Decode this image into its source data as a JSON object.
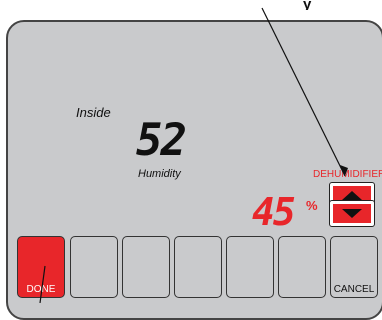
{
  "callout_top": "y",
  "display": {
    "location_label": "Inside",
    "current_value": "52",
    "measure_label": "Humidity",
    "setpoint_value": "45",
    "setpoint_unit": "%",
    "mode_label": "DEHUMIDIFIER"
  },
  "softkeys": {
    "done": "DONE",
    "blank": "",
    "cancel": "CANCEL"
  },
  "colors": {
    "accent": "#e8262a",
    "screen": "#c9cacc"
  },
  "icons": [
    "up-arrow-icon",
    "down-arrow-icon"
  ]
}
